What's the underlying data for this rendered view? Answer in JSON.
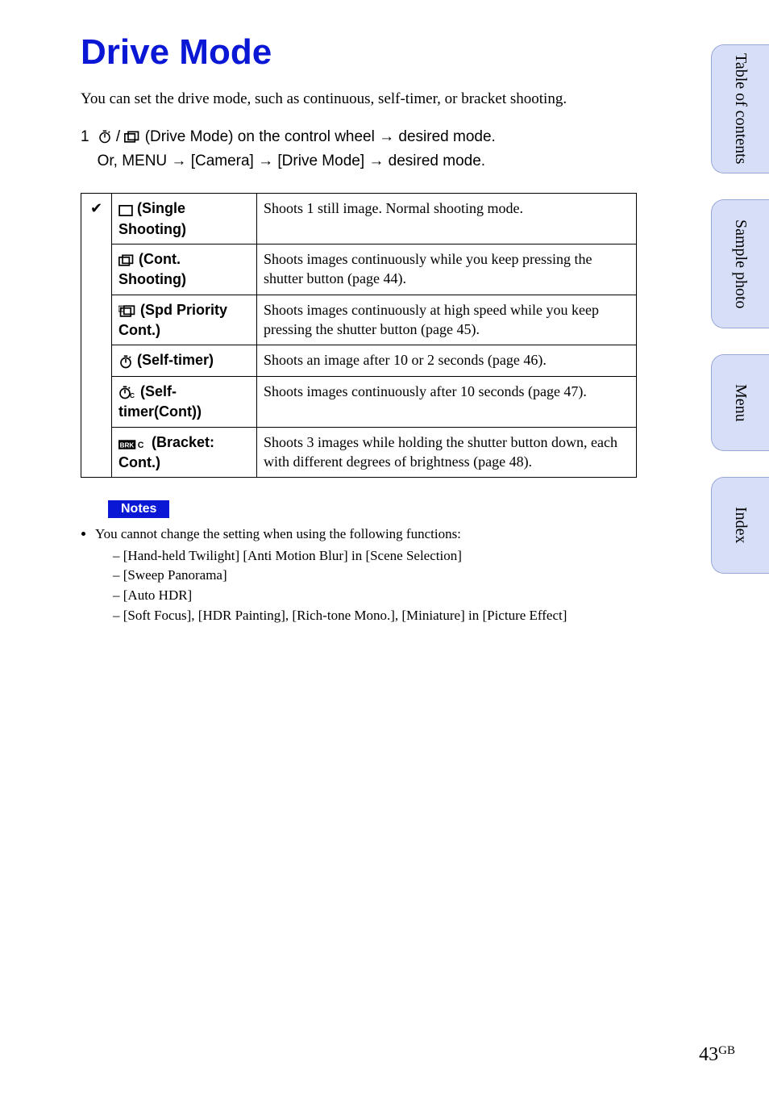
{
  "title": "Drive Mode",
  "intro": "You can set the drive mode, such as continuous, self-timer, or bracket shooting.",
  "step": {
    "num": "1",
    "line1a": " (Drive Mode) on the control wheel ",
    "line1b": " desired mode.",
    "line2a": "Or, MENU ",
    "line2b": " [Camera] ",
    "line2c": " [Drive Mode] ",
    "line2d": " desired mode."
  },
  "table": {
    "rows": [
      {
        "check": "✔",
        "label": " (Single Shooting)",
        "desc": "Shoots 1 still image. Normal shooting mode."
      },
      {
        "check": "",
        "label": " (Cont. Shooting)",
        "desc": "Shoots images continuously while you keep pressing the shutter button (page 44)."
      },
      {
        "check": "",
        "label": " (Spd Priority Cont.)",
        "desc": "Shoots images continuously at high speed while you keep pressing the shutter button (page 45)."
      },
      {
        "check": "",
        "label": " (Self-timer)",
        "desc": "Shoots an image after 10 or 2 seconds (page 46)."
      },
      {
        "check": "",
        "label": " (Self-timer(Cont))",
        "desc": "Shoots images continuously after 10 seconds (page 47)."
      },
      {
        "check": "",
        "label": " (Bracket: Cont.)",
        "desc": "Shoots 3 images while holding the shutter button down, each with different degrees of brightness (page 48)."
      }
    ]
  },
  "notes": {
    "label": "Notes",
    "lead": "You cannot change the setting when using the following functions:",
    "items": [
      "[Hand-held Twilight] [Anti Motion Blur] in [Scene Selection]",
      "[Sweep Panorama]",
      "[Auto HDR]",
      "[Soft Focus], [HDR Painting], [Rich-tone Mono.], [Miniature] in [Picture Effect]"
    ]
  },
  "sidetabs": {
    "toc": "Table of contents",
    "sample": "Sample photo",
    "menu": "Menu",
    "index": "Index"
  },
  "page": {
    "num": "43",
    "region": "GB"
  }
}
